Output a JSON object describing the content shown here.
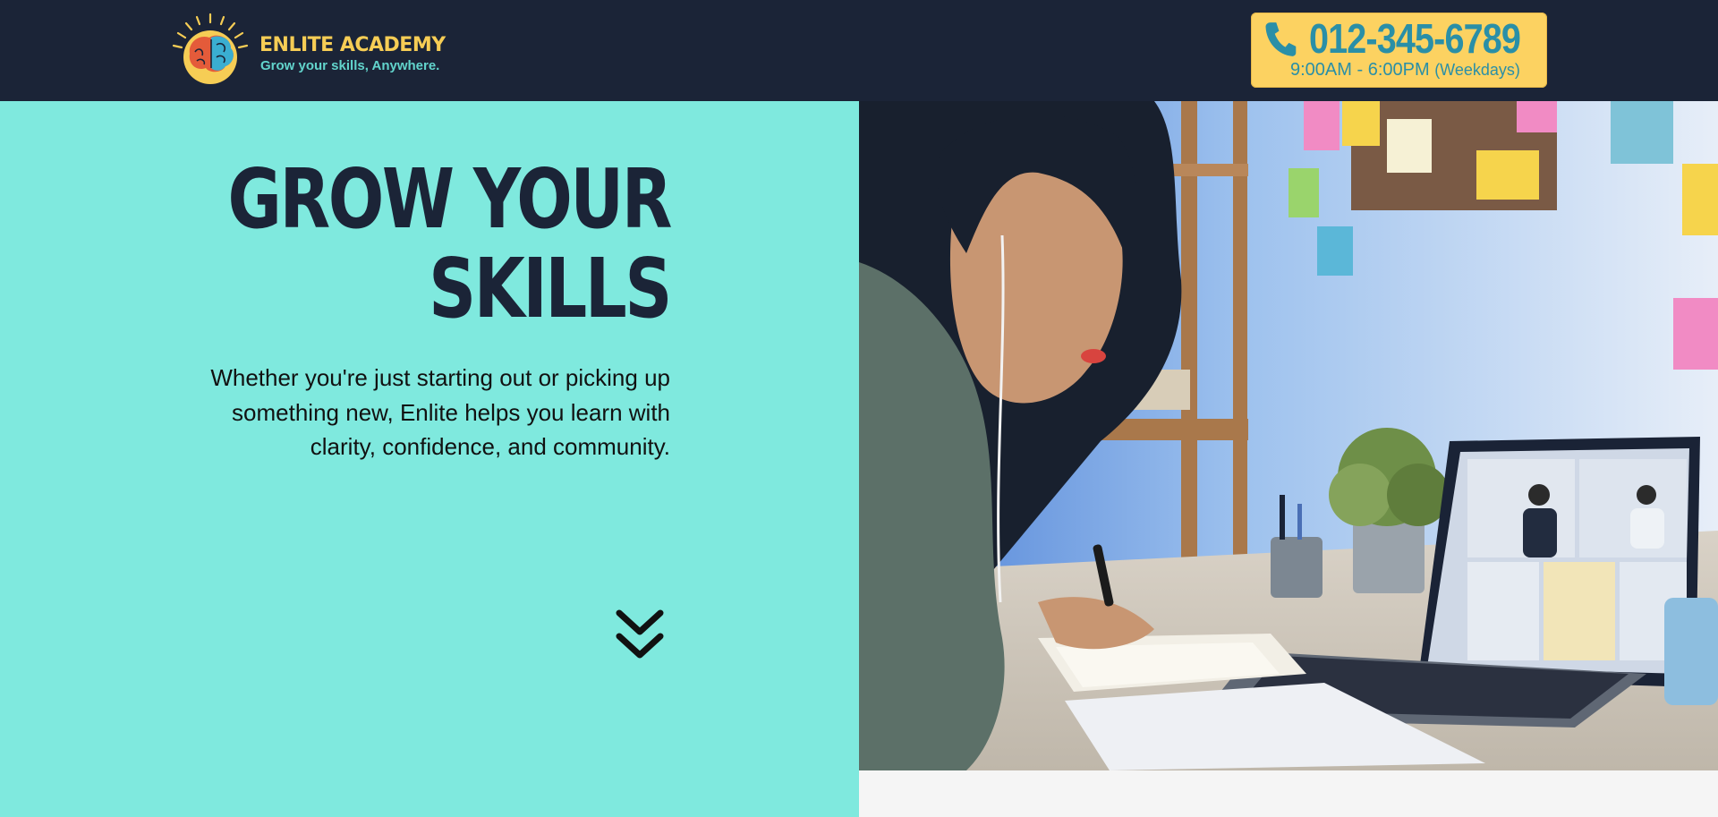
{
  "header": {
    "brand_name": "ENLITE ACADEMY",
    "brand_tagline": "Grow your skills, Anywhere.",
    "logo_icon": "brain-sun-logo",
    "phone": {
      "icon": "phone-icon",
      "number": "012-345-6789",
      "hours": "9:00AM - 6:00PM",
      "hours_note": "(Weekdays)"
    }
  },
  "hero": {
    "title_line1": "GROW YOUR",
    "title_line2": "SKILLS",
    "subtitle": "Whether you're just starting out or picking up something new, Enlite helps you learn with clarity, confidence, and community.",
    "scroll_icon": "double-chevron-down-icon",
    "photo_subject": "woman-studying-video-call-photo"
  },
  "colors": {
    "header_bg": "#1b2437",
    "accent_yellow": "#fcd261",
    "accent_teal": "#2a8fa7",
    "hero_bg": "#7fe9de",
    "text_dark": "#1b2437"
  }
}
